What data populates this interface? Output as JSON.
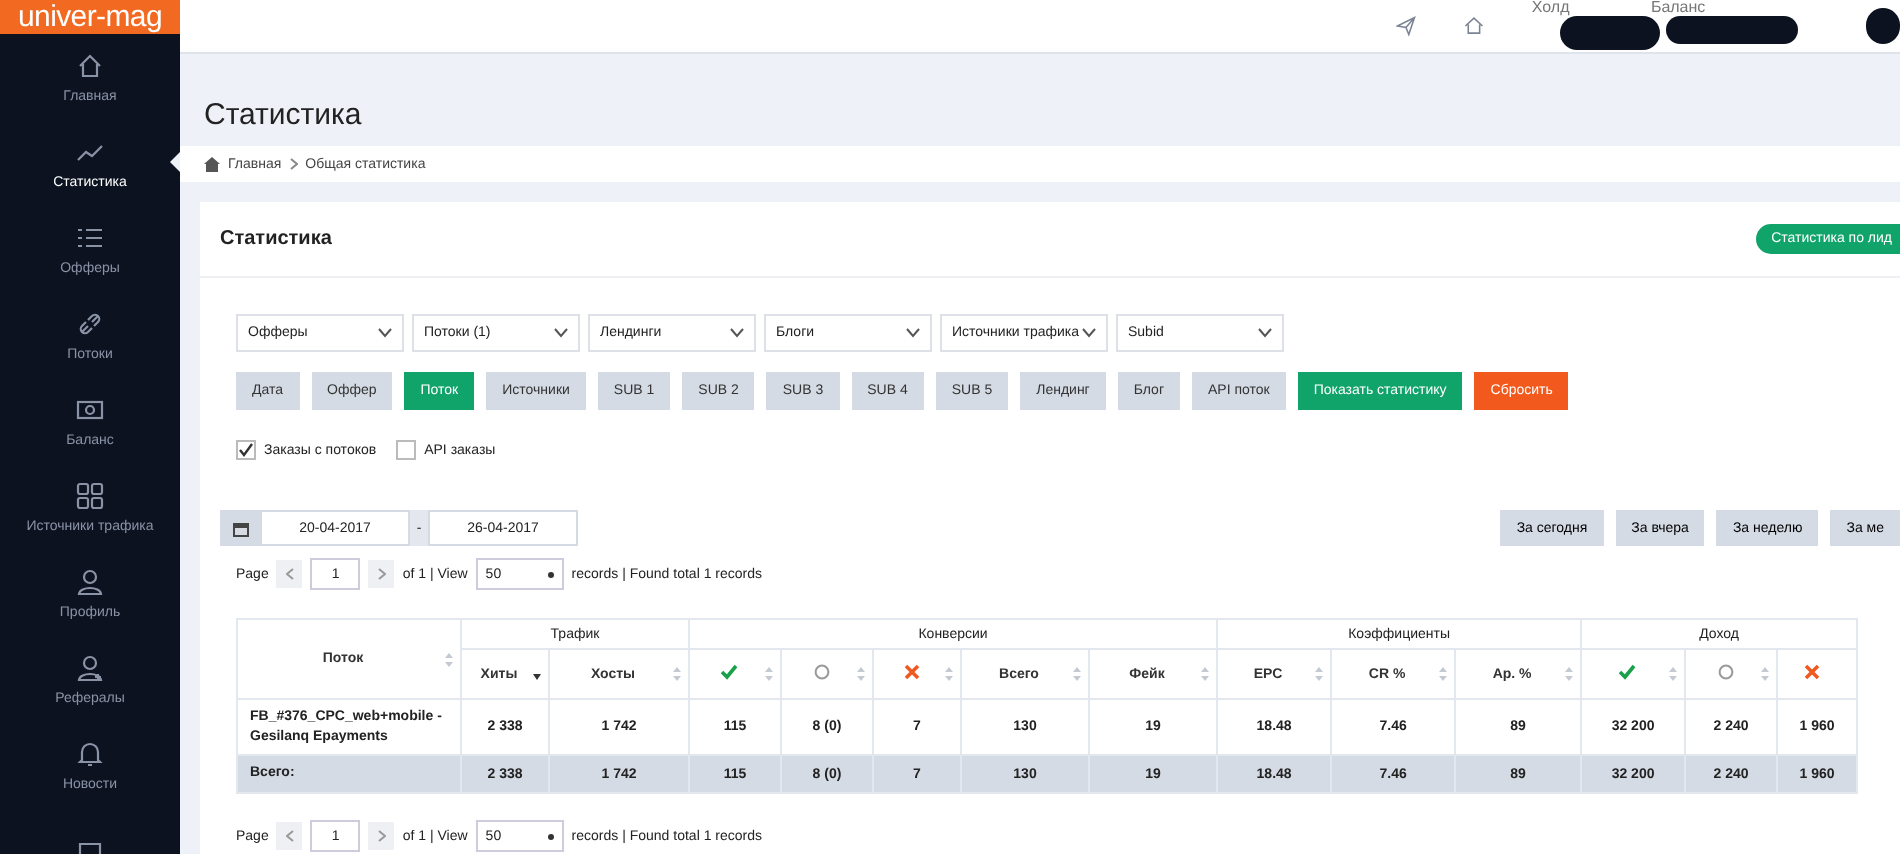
{
  "logo": "univer-mag",
  "header": {
    "hold_label": "Холд",
    "balance_label": "Баланс"
  },
  "sidebar": {
    "items": [
      {
        "label": "Главная",
        "selected": false
      },
      {
        "label": "Статистика",
        "selected": true
      },
      {
        "label": "Офферы",
        "selected": false
      },
      {
        "label": "Потоки",
        "selected": false
      },
      {
        "label": "Баланс",
        "selected": false
      },
      {
        "label": "Источники трафика",
        "selected": false
      },
      {
        "label": "Профиль",
        "selected": false
      },
      {
        "label": "Рефералы",
        "selected": false
      },
      {
        "label": "Новости",
        "selected": false
      },
      {
        "selected": false
      }
    ]
  },
  "page_title": "Статистика",
  "breadcrumb": [
    "Главная",
    "Общая статистика"
  ],
  "card": {
    "title": "Статистика",
    "action_button": "Статистика по лид"
  },
  "filters": [
    "Офферы",
    "Потоки (1)",
    "Лендинги",
    "Блоги",
    "Источники трафика",
    "Subid"
  ],
  "group_buttons": [
    {
      "label": "Дата",
      "selected": false
    },
    {
      "label": "Оффер",
      "selected": false
    },
    {
      "label": "Поток",
      "selected": true
    },
    {
      "label": "Источники",
      "selected": false
    },
    {
      "label": "SUB 1",
      "selected": false
    },
    {
      "label": "SUB 2",
      "selected": false
    },
    {
      "label": "SUB 3",
      "selected": false
    },
    {
      "label": "SUB 4",
      "selected": false
    },
    {
      "label": "SUB 5",
      "selected": false
    },
    {
      "label": "Лендинг",
      "selected": false
    },
    {
      "label": "Блог",
      "selected": false
    },
    {
      "label": "API поток",
      "selected": false
    }
  ],
  "actions": [
    {
      "label": "Показать статистику",
      "kind": "primary"
    },
    {
      "label": "Сбросить",
      "kind": "danger"
    }
  ],
  "checkboxes": [
    {
      "label": "Заказы с потоков",
      "checked": true
    },
    {
      "label": "API заказы",
      "checked": false
    }
  ],
  "date_range": {
    "from": "20-04-2017",
    "separator": "-",
    "to": "26-04-2017"
  },
  "quick_ranges": [
    "За сегодня",
    "За вчера",
    "За неделю",
    "За ме"
  ],
  "pagers": [
    {
      "label": "Page",
      "page": "1",
      "of": "of 1 | View",
      "per_page": "50",
      "found": "records | Found total 1 records"
    },
    {
      "label": "Page",
      "page": "1",
      "of": "of 1 | View",
      "per_page": "50",
      "found": "records | Found total 1 records"
    }
  ],
  "table": {
    "groups": [
      {
        "label": "Трафик"
      },
      {
        "label": "Конверсии"
      },
      {
        "label": "Коэффициенты"
      },
      {
        "label": "Доход"
      }
    ],
    "columns": [
      {
        "label": "Поток",
        "sorted": false
      },
      {
        "kind": "text",
        "label": "Хиты",
        "sorted": true
      },
      {
        "kind": "text",
        "label": "Хосты",
        "sorted": false
      },
      {
        "kind": "check",
        "sorted": false
      },
      {
        "kind": "pending",
        "sorted": false
      },
      {
        "kind": "rejected",
        "sorted": false
      },
      {
        "kind": "text",
        "label": "Всего",
        "sorted": false
      },
      {
        "kind": "text",
        "label": "Фейк",
        "sorted": false
      },
      {
        "kind": "text",
        "label": "EPC",
        "sorted": false
      },
      {
        "kind": "text",
        "label": "CR %",
        "sorted": false
      },
      {
        "kind": "text",
        "label": "Ap. %",
        "sorted": false
      },
      {
        "kind": "check",
        "sorted": false
      },
      {
        "kind": "pending",
        "sorted": false
      },
      {
        "kind": "rejected"
      }
    ],
    "rows": [
      {
        "kind": "data",
        "cells": [
          "FB_#376_CPC_web+mobile - Gesilanq Epayments",
          "2 338",
          "1 742",
          "115",
          "8 (0)",
          "7",
          "130",
          "19",
          "18.48",
          "7.46",
          "89",
          "32 200",
          "2 240",
          "1 960"
        ]
      },
      {
        "kind": "total",
        "cells": [
          "Всего:",
          "2 338",
          "1 742",
          "115",
          "8 (0)",
          "7",
          "130",
          "19",
          "18.48",
          "7.46",
          "89",
          "32 200",
          "2 240",
          "1 960"
        ]
      }
    ]
  }
}
